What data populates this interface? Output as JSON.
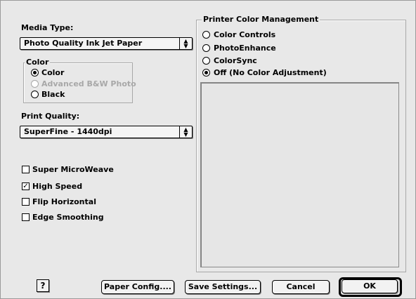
{
  "media_type": {
    "label": "Media Type:",
    "selected": "Photo Quality Ink Jet Paper"
  },
  "color_group": {
    "title": "Color",
    "options": [
      {
        "label": "Color",
        "selected": true,
        "enabled": true
      },
      {
        "label": "Advanced B&W Photo",
        "selected": false,
        "enabled": false
      },
      {
        "label": "Black",
        "selected": false,
        "enabled": true
      }
    ]
  },
  "print_quality": {
    "label": "Print Quality:",
    "selected": "SuperFine - 1440dpi"
  },
  "options": [
    {
      "label": "Super MicroWeave",
      "checked": false
    },
    {
      "label": "High Speed",
      "checked": true
    },
    {
      "label": "Flip Horizontal",
      "checked": false
    },
    {
      "label": "Edge Smoothing",
      "checked": false
    }
  ],
  "color_management": {
    "title": "Printer Color Management",
    "options": [
      {
        "label": "Color Controls",
        "selected": false
      },
      {
        "label": "PhotoEnhance",
        "selected": false
      },
      {
        "label": "ColorSync",
        "selected": false
      },
      {
        "label": "Off (No Color Adjustment)",
        "selected": true
      }
    ]
  },
  "buttons": {
    "help": "?",
    "paper_config": "Paper Config....",
    "save_settings": "Save Settings...",
    "cancel": "Cancel",
    "ok": "OK"
  }
}
